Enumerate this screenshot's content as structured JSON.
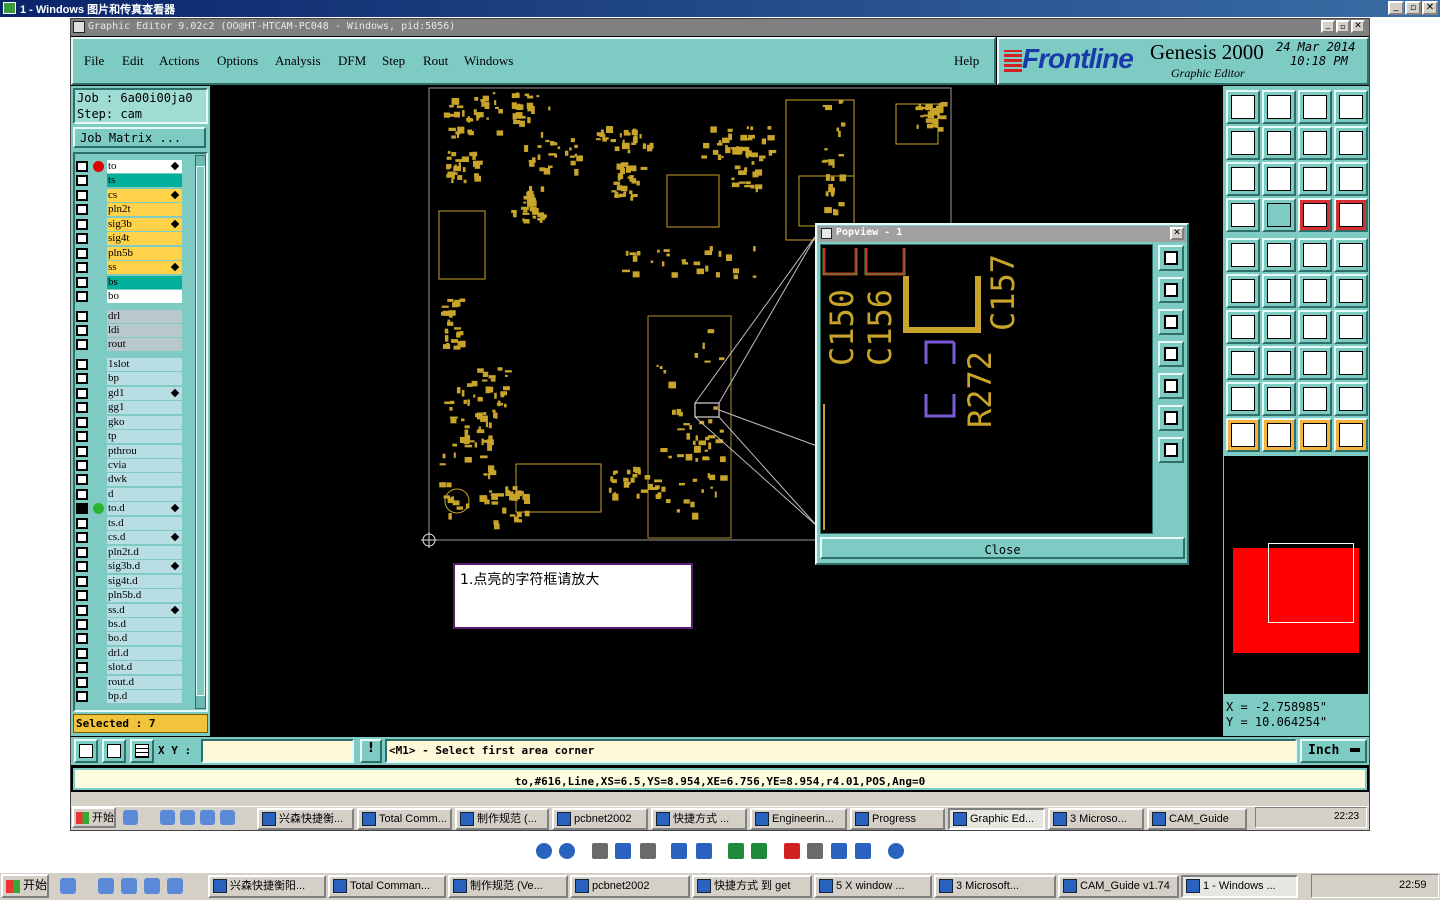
{
  "outer_window": {
    "title": "1 - Windows 图片和传真查看器"
  },
  "app": {
    "title": "Graphic Editor 9.02c2 (OO@HT-HTCAM-PC048 - Windows, pid:5056)",
    "menu": [
      "File",
      "Edit",
      "Actions",
      "Options",
      "Analysis",
      "DFM",
      "Step",
      "Rout",
      "Windows"
    ],
    "help": "Help",
    "brand": "Frontline",
    "product": "Genesis 2000",
    "product_sub": "Graphic Editor",
    "date": "24 Mar 2014",
    "time": "10:18 PM"
  },
  "job": {
    "job_label": "Job  :  6a00i00ja0",
    "step_label": "Step:  cam",
    "matrix_button": "Job Matrix ..."
  },
  "layers": [
    {
      "name": "to",
      "color": "#ffffff",
      "marker": "red",
      "sel": true
    },
    {
      "name": "ts",
      "color": "#00b09a",
      "sel": false
    },
    {
      "name": "cs",
      "color": "#ffd24a",
      "sel": true
    },
    {
      "name": "pln2t",
      "color": "#ffd24a",
      "sel": false
    },
    {
      "name": "sig3b",
      "color": "#ffd24a",
      "sel": true
    },
    {
      "name": "sig4t",
      "color": "#ffd24a",
      "sel": false
    },
    {
      "name": "pln5b",
      "color": "#ffd24a",
      "sel": false
    },
    {
      "name": "ss",
      "color": "#ffd24a",
      "sel": true
    },
    {
      "name": "bs",
      "color": "#00b09a",
      "sel": false
    },
    {
      "name": "bo",
      "color": "#ffffff",
      "sel": false
    },
    {
      "name": "drl",
      "color": "#b8c8cc",
      "sel": false
    },
    {
      "name": "ldi",
      "color": "#b8c8cc",
      "sel": false
    },
    {
      "name": "rout",
      "color": "#b8c8cc",
      "sel": false
    },
    {
      "name": "1slot",
      "color": "#b8dde3",
      "sel": false
    },
    {
      "name": "bp",
      "color": "#b8dde3",
      "sel": false
    },
    {
      "name": "gd1",
      "color": "#b8dde3",
      "sel": true
    },
    {
      "name": "gg1",
      "color": "#b8dde3",
      "sel": false
    },
    {
      "name": "gko",
      "color": "#b8dde3",
      "sel": false
    },
    {
      "name": "tp",
      "color": "#b8dde3",
      "sel": false
    },
    {
      "name": "pthrou",
      "color": "#b8dde3",
      "sel": false
    },
    {
      "name": "cvia",
      "color": "#b8dde3",
      "sel": false
    },
    {
      "name": "dwk",
      "color": "#b8dde3",
      "sel": false
    },
    {
      "name": "d",
      "color": "#b8dde3",
      "sel": false
    },
    {
      "name": "to.d",
      "color": "#b8dde3",
      "marker": "green",
      "sel": true
    },
    {
      "name": "ts.d",
      "color": "#b8dde3",
      "sel": false
    },
    {
      "name": "cs.d",
      "color": "#b8dde3",
      "sel": true
    },
    {
      "name": "pln2t.d",
      "color": "#b8dde3",
      "sel": false
    },
    {
      "name": "sig3b.d",
      "color": "#b8dde3",
      "sel": true
    },
    {
      "name": "sig4t.d",
      "color": "#b8dde3",
      "sel": false
    },
    {
      "name": "pln5b.d",
      "color": "#b8dde3",
      "sel": false
    },
    {
      "name": "ss.d",
      "color": "#b8dde3",
      "sel": true
    },
    {
      "name": "bs.d",
      "color": "#b8dde3",
      "sel": false
    },
    {
      "name": "bo.d",
      "color": "#b8dde3",
      "sel": false
    },
    {
      "name": "drl.d",
      "color": "#b8dde3",
      "sel": false
    },
    {
      "name": "slot.d",
      "color": "#b8dde3",
      "sel": false
    },
    {
      "name": "rout.d",
      "color": "#b8dde3",
      "sel": false
    },
    {
      "name": "bp.d",
      "color": "#b8dde3",
      "sel": false
    }
  ],
  "selected": "Selected : 7",
  "popview": {
    "title": "Popview - 1",
    "close": "Close",
    "labels": [
      "C150",
      "C156",
      "C157",
      "R272"
    ]
  },
  "annotation": "1.点亮的字符框请放大",
  "coords": {
    "x": "X  =  -2.758985\"",
    "y": "Y  =  10.064254\""
  },
  "bottom_bar": {
    "xy_label": "X Y :",
    "xy_value": "",
    "message": "<M1> - Select first area corner",
    "units": "Inch",
    "status": "to,#616,Line,XS=6.5,YS=8.954,XE=6.756,YE=8.954,r4.01,POS,Ang=0"
  },
  "inner_taskbar": {
    "start": "开始",
    "items": [
      "兴森快捷衡...",
      "Total Comm...",
      "制作规范 (...",
      "pcbnet2002",
      "快捷方式 ...",
      "Engineerin...",
      "Progress",
      "Graphic Ed...",
      "3 Microso...",
      "CAM_Guide"
    ],
    "time": "22:23"
  },
  "outer_taskbar": {
    "start": "开始",
    "items": [
      "兴森快捷衡阳...",
      "Total Comman...",
      "制作规范 (Ve...",
      "pcbnet2002",
      "快捷方式 到 get",
      "5 X window ...",
      "3 Microsoft...",
      "CAM_Guide v1.74",
      "1 - Windows ..."
    ],
    "time": "22:59"
  }
}
